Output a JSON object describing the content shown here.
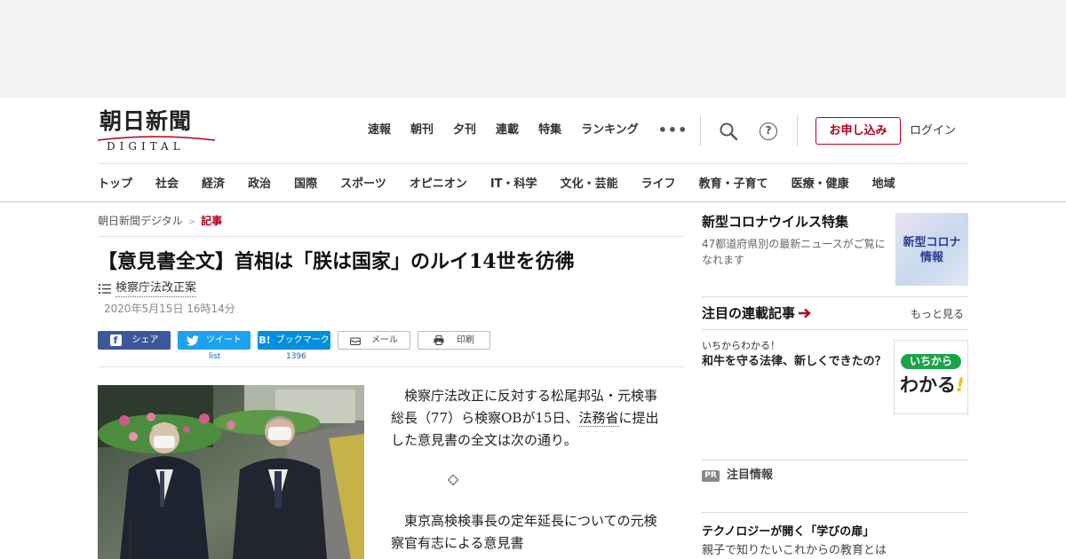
{
  "header": {
    "logo": {
      "kanji": "朝日新聞",
      "sub": "DIGITAL"
    },
    "topnav": [
      "速報",
      "朝刊",
      "夕刊",
      "連載",
      "特集",
      "ランキング"
    ],
    "more_label": "•••",
    "icons": [
      "search-icon",
      "help-icon"
    ],
    "help_glyph": "?",
    "subscribe_label": "お申し込み",
    "login_label": "ログイン",
    "categories": [
      "トップ",
      "社会",
      "経済",
      "政治",
      "国際",
      "スポーツ",
      "オピニオン",
      "IT・科学",
      "文化・芸能",
      "ライフ",
      "教育・子育て",
      "医療・健康",
      "地域"
    ]
  },
  "breadcrumb": {
    "home": "朝日新聞デジタル",
    "sep": ">",
    "current": "記事"
  },
  "article": {
    "title": "【意見書全文】首相は「朕は国家」のルイ14世を彷彿",
    "tag": "検察庁法改正案",
    "date": "2020年5月15日 16時14分",
    "share": {
      "facebook": "シェア",
      "facebook_glyph": "f",
      "twitter": "ツイート",
      "hatena": "ブックマーク",
      "hatena_glyph": "B!",
      "mail": "メール",
      "print": "印刷",
      "twitter_count": "list",
      "hatena_count": "1396"
    },
    "body": {
      "p1_pre": "　検察庁法改正に反対する松尾邦弘・元検事総長（77）ら検察OBが15日、",
      "p1_link": "法務省",
      "p1_post": "に提出した意見書の全文は次の通り。",
      "diamond": "◇",
      "p2_link": "東京高検検事長の定年延長",
      "p2_post": "についての元検察官有志による意見書"
    }
  },
  "sidebar": {
    "corona": {
      "title": "新型コロナウイルス特集",
      "desc": "47都道府県別の最新ニュースがご覧になれます",
      "thumb_line1": "新型コロナ",
      "thumb_line2": "情報"
    },
    "series": {
      "title": "注目の連載記事",
      "more": "もっと見る",
      "kicker": "いちからわかる！",
      "headline": "和牛を守る法律、新しくできたの？",
      "thumb_pill": "いちから",
      "thumb_main": "わかる",
      "thumb_bang": "!"
    },
    "pr": {
      "badge": "PR",
      "label": "注目情報"
    },
    "tech": {
      "headline": "テクノロジーが開く「学びの扉」",
      "sub": "親子で知りたいこれからの教育とは"
    }
  },
  "colors": {
    "brand_red": "#b3001c",
    "facebook": "#3b5998",
    "twitter": "#1da1f2",
    "hatena": "#008fde"
  }
}
